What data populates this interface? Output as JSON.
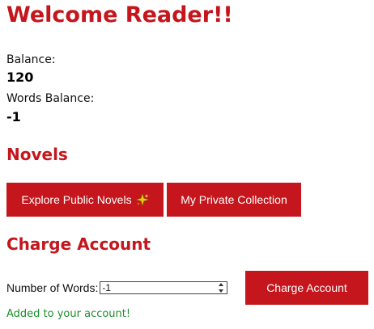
{
  "welcome": {
    "title": "Welcome Reader!!"
  },
  "account": {
    "balance_label": "Balance:",
    "balance_value": "120",
    "words_balance_label": "Words Balance:",
    "words_balance_value": "-1"
  },
  "novels": {
    "title": "Novels",
    "explore_label": "Explore Public Novels",
    "explore_icon": "sparkle-icon",
    "private_label": "My Private Collection"
  },
  "charge": {
    "title": "Charge Account",
    "words_label": "Number of Words:",
    "words_value": "-1",
    "button_label": "Charge Account",
    "status_message": "Added to your account!"
  },
  "colors": {
    "accent": "#c4161c",
    "success": "#1e8f2e",
    "button_text": "#ffffff"
  }
}
